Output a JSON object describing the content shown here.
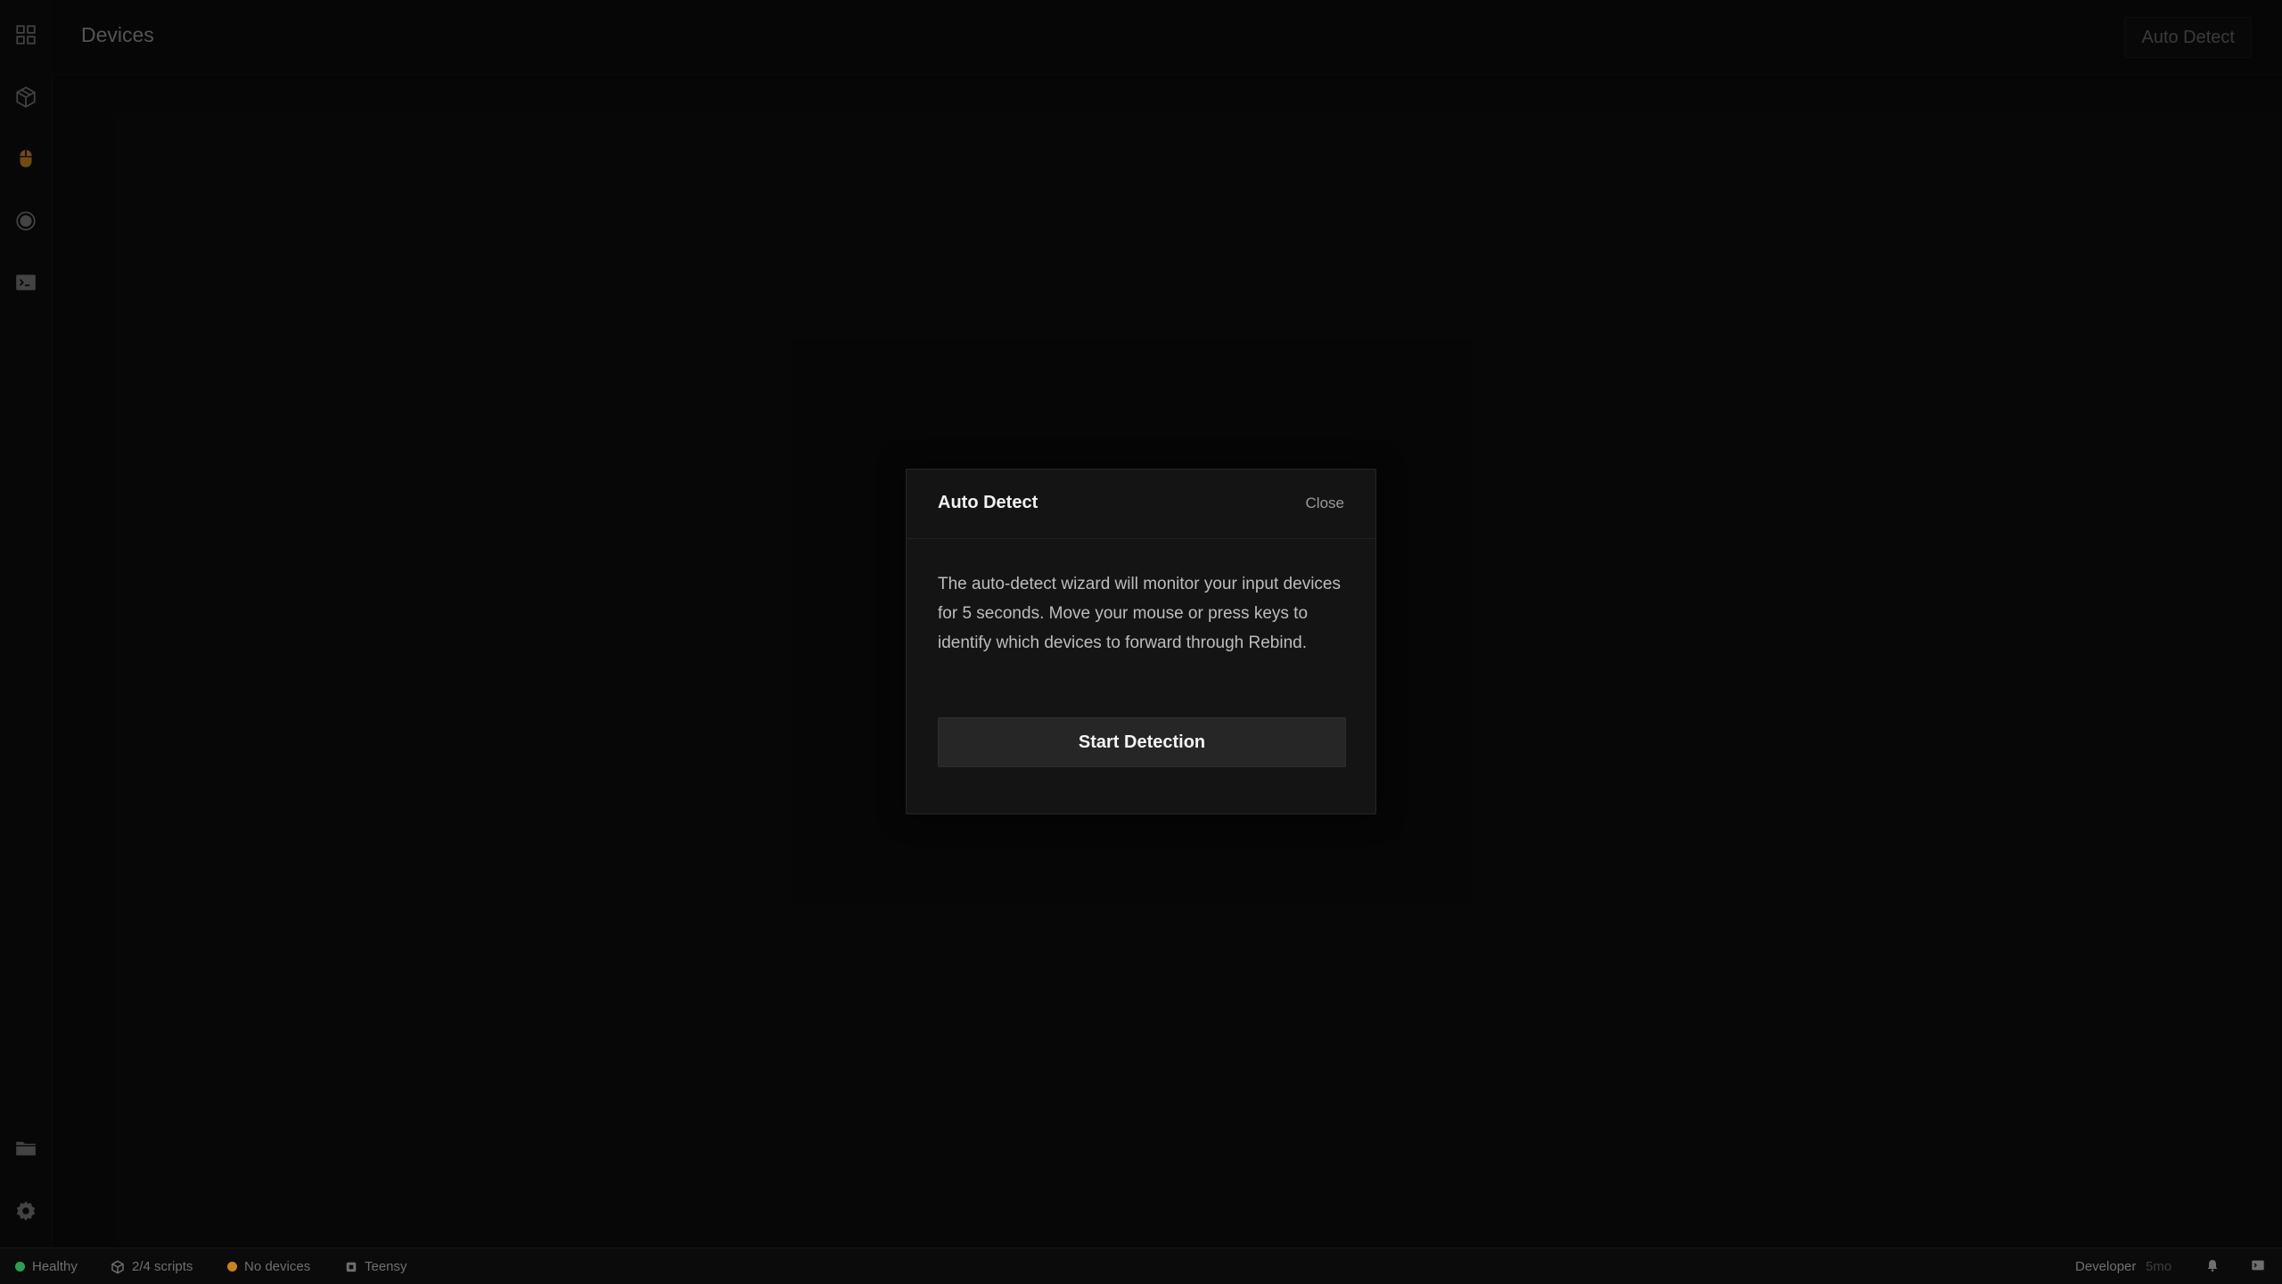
{
  "header": {
    "title": "Devices",
    "auto_detect_label": "Auto Detect"
  },
  "sidebar": {
    "items": [
      {
        "icon": "grid-icon",
        "label": "Dashboard"
      },
      {
        "icon": "package-icon",
        "label": "Scripts"
      },
      {
        "icon": "mouse-icon",
        "label": "Devices",
        "active": true
      },
      {
        "icon": "record-icon",
        "label": "Record"
      },
      {
        "icon": "terminal-icon",
        "label": "Console"
      }
    ],
    "bottom": [
      {
        "icon": "folder-icon"
      },
      {
        "icon": "gear-icon"
      }
    ]
  },
  "modal": {
    "title": "Auto Detect",
    "close_label": "Close",
    "body": "The auto-detect wizard will monitor your input devices for 5 seconds. Move your mouse or press keys to identify which devices to forward through Rebind.",
    "start_label": "Start Detection"
  },
  "status": {
    "health": "Healthy",
    "scripts": "2/4 scripts",
    "devices": "No devices",
    "board": "Teensy",
    "mode": "Developer",
    "mode_sub": "5mo"
  },
  "colors": {
    "accent": "#d08a1c",
    "healthy": "#2e9e55",
    "warning": "#c98318"
  }
}
